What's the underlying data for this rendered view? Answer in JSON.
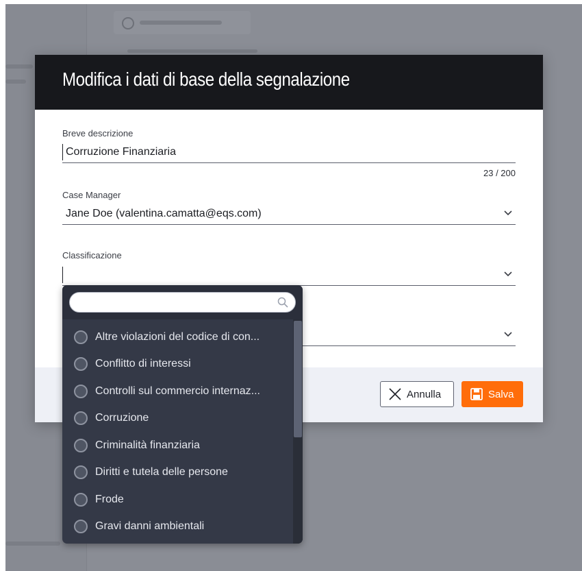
{
  "modal": {
    "title": "Modifica i dati di base della segnalazione",
    "fields": {
      "description": {
        "label": "Breve descrizione",
        "value": "Corruzione Finanziaria",
        "counter": "23 / 200"
      },
      "case_manager": {
        "label": "Case Manager",
        "value": "Jane Doe (valentina.camatta@eqs.com)"
      },
      "classification": {
        "label": "Classificazione",
        "value": ""
      },
      "hidden_select": {
        "value": ""
      }
    },
    "footer": {
      "cancel_label": "Annulla",
      "save_label": "Salva"
    }
  },
  "dropdown": {
    "search_placeholder": "",
    "options": [
      "Altre violazioni del codice di con...",
      "Conflitto di interessi",
      "Controlli sul commercio internaz...",
      "Corruzione",
      "Criminalità finanziaria",
      "Diritti e tutela delle persone",
      "Frode",
      "Gravi danni ambientali"
    ]
  },
  "colors": {
    "header_bg": "#17181c",
    "accent": "#ff6d0a",
    "dropdown_bg": "#343947"
  },
  "icons": {
    "chevron": "chevron-down-icon",
    "search": "search-icon",
    "cancel": "close-icon",
    "save": "save-icon"
  }
}
